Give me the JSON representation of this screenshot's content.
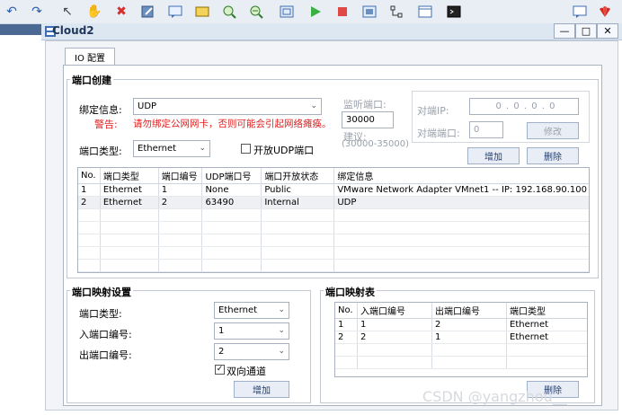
{
  "window": {
    "title": "Cloud2"
  },
  "tab": {
    "label": "IO 配置"
  },
  "port_create": {
    "title": "端口创建",
    "bind_label": "绑定信息:",
    "bind_value": "UDP",
    "warning_label": "警告:",
    "warning_text": "请勿绑定公网网卡，否则可能会引起网络瘫痪。",
    "port_type_label": "端口类型:",
    "port_type_value": "Ethernet",
    "open_udp_label": "开放UDP端口",
    "listen_port_label": "监听端口:",
    "listen_port_value": "30000",
    "suggest_label": "建议:",
    "suggest_range": "(30000-35000)",
    "peer_ip_label": "对端IP:",
    "peer_ip_value": "0 . 0 . 0 . 0",
    "peer_port_label": "对端端口:",
    "peer_port_value": "0",
    "modify_button": "修改",
    "add_button": "增加",
    "delete_button": "删除",
    "table": {
      "headers": [
        "No.",
        "端口类型",
        "端口编号",
        "UDP端口号",
        "端口开放状态",
        "绑定信息"
      ],
      "rows": [
        [
          "1",
          "Ethernet",
          "1",
          "None",
          "Public",
          "VMware Network Adapter VMnet1 -- IP: 192.168.90.100"
        ],
        [
          "2",
          "Ethernet",
          "2",
          "63490",
          "Internal",
          "UDP"
        ]
      ]
    }
  },
  "port_map_settings": {
    "title": "端口映射设置",
    "port_type_label": "端口类型:",
    "port_type_value": "Ethernet",
    "in_port_label": "入端口编号:",
    "in_port_value": "1",
    "out_port_label": "出端口编号:",
    "out_port_value": "2",
    "bidirectional_label": "双向通道",
    "bidirectional_checked": true,
    "add_button": "增加"
  },
  "port_map_table": {
    "title": "端口映射表",
    "headers": [
      "No.",
      "入端口编号",
      "出端口编号",
      "端口类型"
    ],
    "rows": [
      [
        "1",
        "1",
        "2",
        "Ethernet"
      ],
      [
        "2",
        "2",
        "1",
        "Ethernet"
      ]
    ],
    "delete_button": "删除"
  },
  "watermark": "CSDN @yangzhou__"
}
